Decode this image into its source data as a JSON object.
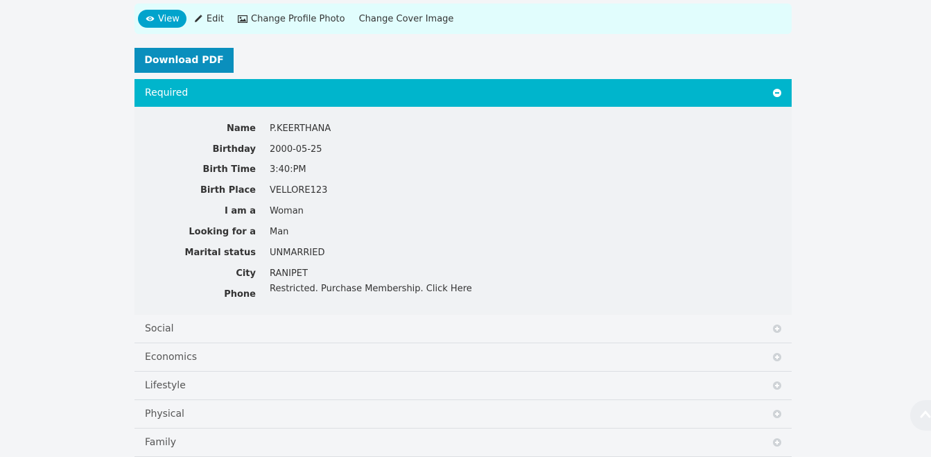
{
  "tabs": [
    {
      "label": "View",
      "icon": "eye-icon",
      "active": true
    },
    {
      "label": "Edit",
      "icon": "pencil-icon",
      "active": false
    },
    {
      "label": "Change Profile Photo",
      "icon": "image-icon",
      "active": false
    },
    {
      "label": "Change Cover Image",
      "icon": "",
      "active": false
    }
  ],
  "download_label": "Download PDF",
  "required_panel": {
    "title": "Required",
    "toggle_icon": "minus-circle-icon",
    "fields": [
      {
        "label": "Name",
        "value": "P.KEERTHANA"
      },
      {
        "label": "Birthday",
        "value": "2000-05-25"
      },
      {
        "label": "Birth Time",
        "value": "3:40:PM"
      },
      {
        "label": "Birth Place",
        "value": "VELLORE123"
      },
      {
        "label": "I am a",
        "value": "Woman"
      },
      {
        "label": "Looking for a",
        "value": "Man"
      },
      {
        "label": "Marital status",
        "value": "UNMARRIED"
      },
      {
        "label": "City",
        "value": "RANIPET"
      },
      {
        "label": "Phone",
        "value": "Restricted. Purchase Membership. Click Here"
      }
    ]
  },
  "collapsed_panels": [
    {
      "title": "Social",
      "toggle_icon": "plus-circle-icon"
    },
    {
      "title": "Economics",
      "toggle_icon": "plus-circle-icon"
    },
    {
      "title": "Lifestyle",
      "toggle_icon": "plus-circle-icon"
    },
    {
      "title": "Physical",
      "toggle_icon": "plus-circle-icon"
    },
    {
      "title": "Family",
      "toggle_icon": "plus-circle-icon"
    }
  ],
  "colors": {
    "tabbar_bg": "#e1fdfd",
    "active_tab": "#01a3cc",
    "download_button": "#0a8fbd",
    "open_panel_header": "#00b5cc"
  },
  "scroll_top_icon": "chevron-up-icon"
}
